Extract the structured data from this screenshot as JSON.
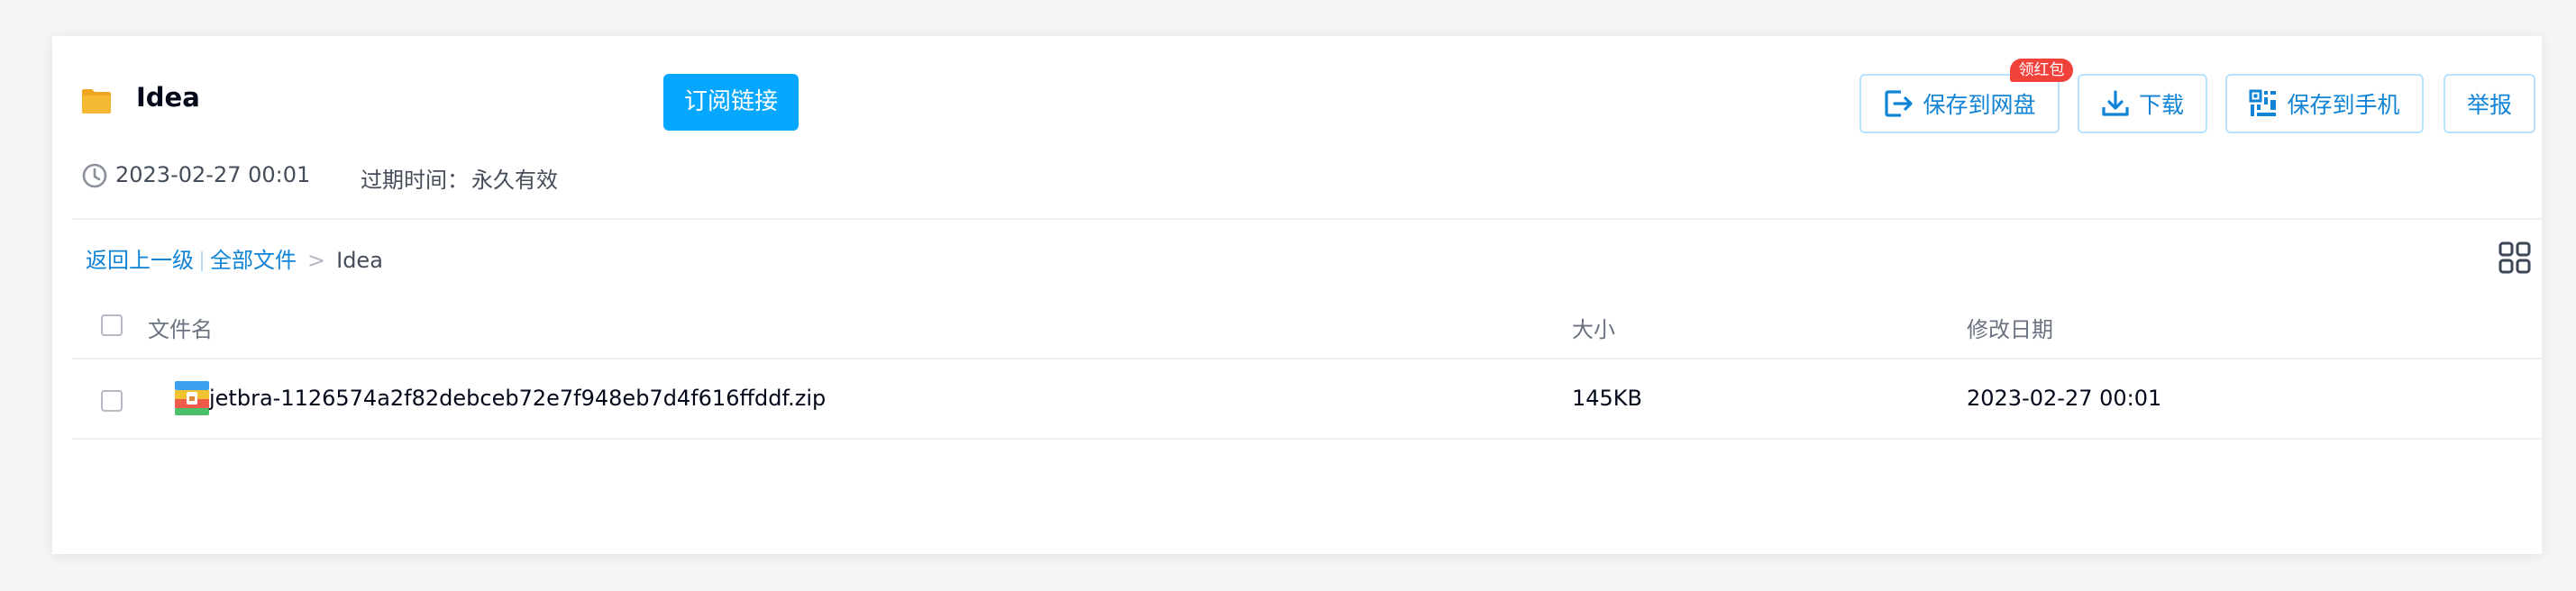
{
  "folder": {
    "title": "Idea",
    "date": "2023-02-27 00:01",
    "expiry_label": "过期时间：",
    "expiry_value": "永久有效"
  },
  "subscribe_button": "订阅链接",
  "actions": {
    "save_label": "保存到网盘",
    "save_badge": "领红包",
    "download_label": "下载",
    "save_to_phone_label": "保存到手机",
    "report_label": "举报"
  },
  "breadcrumb": {
    "back": "返回上一级",
    "all_files": "全部文件",
    "separator": ">",
    "current": "Idea"
  },
  "table": {
    "columns": [
      "文件名",
      "大小",
      "修改日期"
    ],
    "rows": [
      {
        "name": "jetbra-1126574a2f82debceb72e7f948eb7d4f616ffddf.zip",
        "size": "145KB",
        "modified": "2023-02-27 00:01",
        "icon": "zip-file-icon"
      }
    ]
  },
  "colors": {
    "accent": "#06a7ff",
    "link": "#0f83d6",
    "button_border": "#b8e2ff",
    "badge": "#f0413b",
    "text": "#03081a",
    "muted": "#6b7280",
    "folder": "#f5b832"
  },
  "icons": [
    "folder-icon",
    "clock-icon",
    "save-to-cloud-icon",
    "download-icon",
    "qr-phone-icon",
    "grid-view-icon",
    "zip-file-icon"
  ]
}
